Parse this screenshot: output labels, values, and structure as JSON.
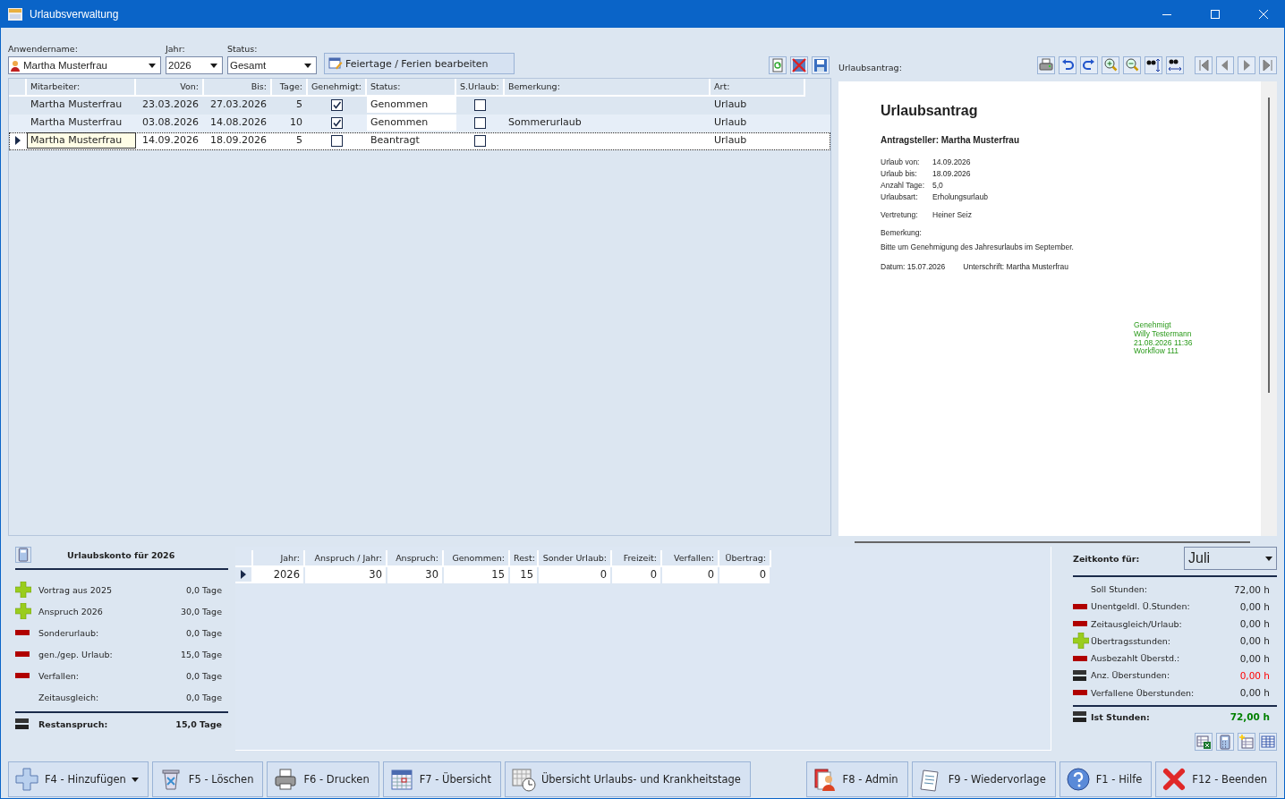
{
  "window": {
    "title": "Urlaubsverwaltung"
  },
  "filters": {
    "user_label": "Anwendername:",
    "user": "Martha Musterfrau",
    "year_label": "Jahr:",
    "year": "2026",
    "status_label": "Status:",
    "status": "Gesamt",
    "holidays_button": "Feiertage / Ferien bearbeiten"
  },
  "table": {
    "columns": [
      "Mitarbeiter:",
      "Von:",
      "Bis:",
      "Tage:",
      "Genehmigt:",
      "Status:",
      "S.Urlaub:",
      "Bemerkung:",
      "Art:"
    ],
    "rows": [
      {
        "employee": "Martha Musterfrau",
        "from": "23.03.2026",
        "to": "27.03.2026",
        "days": "5",
        "approved": true,
        "status": "Genommen",
        "special": false,
        "remark": "",
        "type": "Urlaub",
        "selected": false
      },
      {
        "employee": "Martha Musterfrau",
        "from": "03.08.2026",
        "to": "14.08.2026",
        "days": "10",
        "approved": true,
        "status": "Genommen",
        "special": false,
        "remark": "Sommerurlaub",
        "type": "Urlaub",
        "selected": false
      },
      {
        "employee": "Martha Musterfrau",
        "from": "14.09.2026",
        "to": "18.09.2026",
        "days": "5",
        "approved": false,
        "status": "Beantragt",
        "special": false,
        "remark": "",
        "type": "Urlaub",
        "selected": true
      }
    ]
  },
  "preview": {
    "label": "Urlaubsantrag:",
    "title": "Urlaubsantrag",
    "applicant": "Antragsteller: Martha Musterfrau",
    "fields": [
      {
        "label": "Urlaub von:",
        "value": "14.09.2026"
      },
      {
        "label": "Urlaub bis:",
        "value": "18.09.2026"
      },
      {
        "label": "Anzahl Tage:",
        "value": "5,0"
      },
      {
        "label": "Urlaubsart:",
        "value": "Erholungsurlaub"
      }
    ],
    "substitute_label": "Vertretung:",
    "substitute": "Heiner Seiz",
    "remark_label": "Bemerkung:",
    "remark": "Bitte um Genehmigung des Jahresurlaubs im September.",
    "date": "Datum: 15.07.2026",
    "signature": "Unterschrift: Martha Musterfrau",
    "approval": [
      "Genehmigt",
      "Willy Testermann",
      "21.08.2026 11:36",
      "Workflow 111"
    ]
  },
  "account": {
    "title": "Urlaubskonto für 2026",
    "items": [
      {
        "kind": "plus",
        "label": "Vortrag aus 2025",
        "value": "0,0 Tage"
      },
      {
        "kind": "plus",
        "label": "Anspruch 2026",
        "value": "30,0 Tage"
      },
      {
        "kind": "minus",
        "label": "Sonderurlaub:",
        "value": "0,0 Tage"
      },
      {
        "kind": "minus",
        "label": "gen./gep. Urlaub:",
        "value": "15,0 Tage"
      },
      {
        "kind": "minus",
        "label": "Verfallen:",
        "value": "0,0 Tage"
      },
      {
        "kind": "none",
        "label": "Zeitausgleich:",
        "value": "0,0 Tage"
      }
    ],
    "total": {
      "label": "Restanspruch:",
      "value": "15,0 Tage"
    }
  },
  "entitlement_table": {
    "columns": [
      "Jahr:",
      "Anspruch / Jahr:",
      "Anspruch:",
      "Genommen:",
      "Rest:",
      "Sonder Urlaub:",
      "Freizeit:",
      "Verfallen:",
      "Übertrag:"
    ],
    "rows": [
      {
        "cells": [
          "2026",
          "30",
          "30",
          "15",
          "15",
          "0",
          "0",
          "0",
          "0"
        ],
        "selected": true
      }
    ]
  },
  "time_account": {
    "label": "Zeitkonto für:",
    "month": "Juli",
    "items": [
      {
        "kind": "none",
        "label": "Soll Stunden:",
        "value": "72,00 h"
      },
      {
        "kind": "minus",
        "label": "Unentgeldl. Ü.Stunden:",
        "value": "0,00 h"
      },
      {
        "kind": "minus",
        "label": "Zeitausgleich/Urlaub:",
        "value": "0,00 h"
      },
      {
        "kind": "plus",
        "label": "Übertragsstunden:",
        "value": "0,00 h"
      },
      {
        "kind": "minus",
        "label": "Ausbezahlt Überstd.:",
        "value": "0,00 h"
      },
      {
        "kind": "equal",
        "label": "Anz. Überstunden:",
        "value": "0,00 h",
        "color": "#ff0000"
      },
      {
        "kind": "minus",
        "label": "Verfallene Überstunden:",
        "value": "0,00 h"
      }
    ],
    "total": {
      "kind": "equal",
      "label": "Ist Stunden:",
      "value": "72,00 h",
      "color": "#008000"
    }
  },
  "footer_buttons": [
    {
      "kind": "add",
      "label": "F4 - Hinzufügen"
    },
    {
      "kind": "delete",
      "label": "F5 - Löschen"
    },
    {
      "kind": "print",
      "label": "F6 - Drucken"
    },
    {
      "kind": "calendar",
      "label": "F7 - Übersicht"
    },
    {
      "kind": "clock",
      "label": "Übersicht Urlaubs- und Krankheitstage"
    },
    {
      "kind": "admin",
      "label": "F8 - Admin"
    },
    {
      "kind": "notes",
      "label": "F9 - Wiedervorlage"
    },
    {
      "kind": "help",
      "label": "F1 - Hilfe"
    },
    {
      "kind": "exit",
      "label": "F12 - Beenden"
    }
  ]
}
